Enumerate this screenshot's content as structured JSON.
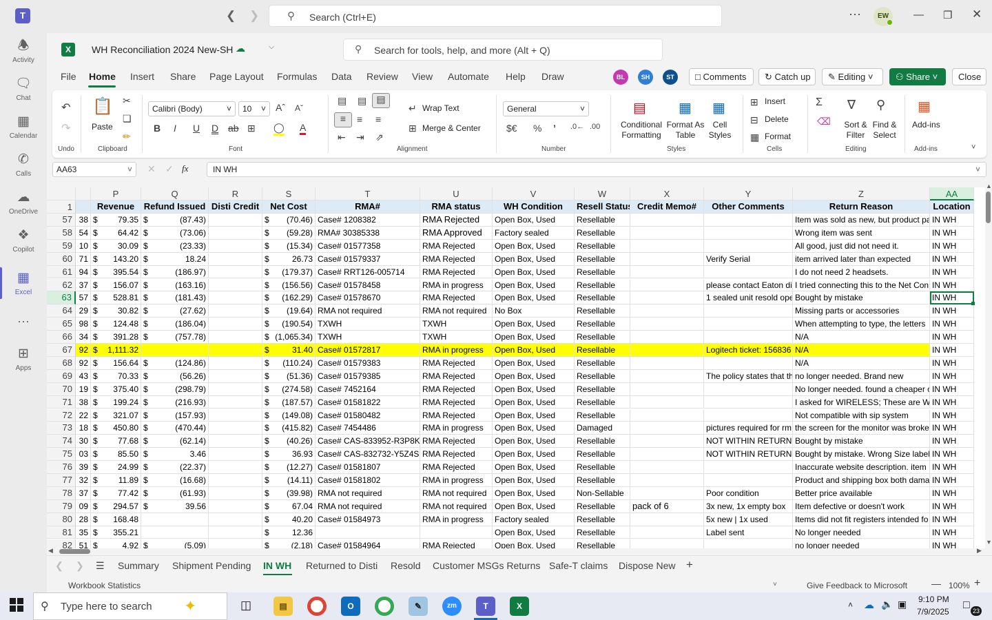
{
  "teams": {
    "search_placeholder": "Search (Ctrl+E)",
    "user_initials": "EW",
    "rail": [
      {
        "label": "Activity",
        "icon": "bell-icon"
      },
      {
        "label": "Chat",
        "icon": "chat-icon"
      },
      {
        "label": "Calendar",
        "icon": "calendar-icon"
      },
      {
        "label": "Calls",
        "icon": "phone-icon"
      },
      {
        "label": "OneDrive",
        "icon": "cloud-icon"
      },
      {
        "label": "Copilot",
        "icon": "copilot-icon"
      },
      {
        "label": "Excel",
        "icon": "excel-icon"
      },
      {
        "label": "Apps",
        "icon": "plus-square-icon"
      }
    ]
  },
  "workbook": {
    "name": "WH Reconciliation 2024 New-SH",
    "tool_search": "Search for tools, help, and more (Alt + Q)"
  },
  "menu": {
    "tabs": [
      "File",
      "Home",
      "Insert",
      "Share",
      "Page Layout",
      "Formulas",
      "Data",
      "Review",
      "View",
      "Automate",
      "Help",
      "Draw"
    ],
    "collaborators": [
      {
        "initials": "BL",
        "color": "#c239b3"
      },
      {
        "initials": "SH",
        "color": "#2f7fd6"
      },
      {
        "initials": "ST",
        "color": "#0e4f8c"
      }
    ],
    "comments": "Comments",
    "catchup": "Catch up",
    "editing": "Editing",
    "share": "Share",
    "close": "Close"
  },
  "ribbon": {
    "undo": "Undo",
    "paste": "Paste",
    "clipboard": "Clipboard",
    "font_name": "Calibri (Body)",
    "font_size": "10",
    "font": "Font",
    "wrap_text": "Wrap Text",
    "merge_center": "Merge & Center",
    "alignment": "Alignment",
    "number_format": "General",
    "number": "Number",
    "cond_format": "Conditional Formatting",
    "format_table": "Format As Table",
    "cell_styles": "Cell Styles",
    "styles": "Styles",
    "insert": "Insert",
    "delete": "Delete",
    "format": "Format",
    "cells": "Cells",
    "sort_filter": "Sort & Filter",
    "find_select": "Find & Select",
    "editing": "Editing",
    "addins": "Add-ins"
  },
  "formula_bar": {
    "name_box": "AA63",
    "content": "IN WH"
  },
  "grid": {
    "columns": [
      "P",
      "Q",
      "R",
      "S",
      "T",
      "U",
      "V",
      "W",
      "X",
      "Y",
      "Z",
      "AA"
    ],
    "header_row": [
      "Revenue",
      "Refund Issued",
      "Disti Credit",
      "Net Cost",
      "RMA#",
      "RMA status",
      "WH Condition",
      "Resell Status",
      "Credit Memo#",
      "Other Comments",
      "Return Reason",
      "Location"
    ],
    "rows": [
      {
        "n": "57",
        "o": "38",
        "p": "79.35",
        "q": "(87.43)",
        "s": "(70.46)",
        "t": "Case# 1208382",
        "u": "RMA Rejected",
        "v": "Open Box, Used",
        "w": "Resellable",
        "x": "",
        "y": "",
        "z": "Item was sold as new, but product pa",
        "aa": "IN WH"
      },
      {
        "n": "58",
        "o": "54",
        "p": "64.42",
        "q": "(73.06)",
        "s": "(59.28)",
        "t": "RMA# 30385338",
        "u": "RMA Approved",
        "v": "Factory sealed",
        "w": "Resellable",
        "x": "",
        "y": "",
        "z": "Wrong item was sent",
        "aa": "IN WH"
      },
      {
        "n": "59",
        "o": "10",
        "p": "30.09",
        "q": "(23.33)",
        "s": "(15.34)",
        "t": "Case# 01577358",
        "u": "RMA Rejected",
        "v": "Open Box, Used",
        "w": "Resellable",
        "x": "",
        "y": "",
        "z": "All good, just did not need it.",
        "aa": "IN WH"
      },
      {
        "n": "60",
        "o": "71",
        "p": "143.20",
        "q": "18.24",
        "s": "26.73",
        "t": "Case# 01579337",
        "u": "RMA Rejected",
        "v": "Open Box, Used",
        "w": "Resellable",
        "x": "",
        "y": "Verify Serial",
        "z": "item arrived later than expected",
        "aa": "IN WH"
      },
      {
        "n": "61",
        "o": "94",
        "p": "395.54",
        "q": "(186.97)",
        "s": "(179.37)",
        "t": "Case# RRT126-005714",
        "u": "RMA Rejected",
        "v": "Open Box, Used",
        "w": "Resellable",
        "x": "",
        "y": "",
        "z": "I do not need 2 headsets.",
        "aa": "IN WH"
      },
      {
        "n": "62",
        "o": "37",
        "p": "156.07",
        "q": "(163.16)",
        "s": "(156.56)",
        "t": "Case# 01578458",
        "u": "RMA in progress",
        "v": "Open Box, Used",
        "w": "Resellable",
        "x": "",
        "y": "please contact Eaton dir",
        "z": "I tried connecting this to the Net Con",
        "aa": "IN WH"
      },
      {
        "n": "63",
        "o": "57",
        "p": "528.81",
        "q": "(181.43)",
        "s": "(162.29)",
        "t": "Case# 01578670",
        "u": "RMA Rejected",
        "v": "Open Box, Used",
        "w": "Resellable",
        "x": "",
        "y": "1 sealed unit resold ope",
        "z": "Bought by mistake",
        "aa": "IN WH"
      },
      {
        "n": "64",
        "o": "29",
        "p": "30.82",
        "q": "(27.62)",
        "s": "(19.64)",
        "t": "RMA not required",
        "u": "RMA not required",
        "v": "No Box",
        "w": "Resellable",
        "x": "",
        "y": "",
        "z": "Missing parts or accessories",
        "aa": "IN WH"
      },
      {
        "n": "65",
        "o": "98",
        "p": "124.48",
        "q": "(186.04)",
        "s": "(190.54)",
        "t": "TXWH",
        "u": "TXWH",
        "v": "Open Box, Used",
        "w": "Resellable",
        "x": "",
        "y": "",
        "z": "When attempting to type, the letters",
        "aa": "IN WH"
      },
      {
        "n": "66",
        "o": "34",
        "p": "391.28",
        "q": "(757.78)",
        "s": "(1,065.34)",
        "t": "TXWH",
        "u": "TXWH",
        "v": "Open Box, Used",
        "w": "Resellable",
        "x": "",
        "y": "",
        "z": "N/A",
        "aa": "IN WH"
      },
      {
        "n": "67",
        "o": "92",
        "p": "1,111.32",
        "q": "",
        "s": "31.40",
        "t": "Case# 01572817",
        "u": "RMA in progress",
        "v": "Open Box, Used",
        "w": "Resellable",
        "x": "",
        "y": "Logitech ticket: 156836",
        "z": "N/A",
        "aa": "IN WH"
      },
      {
        "n": "68",
        "o": "92",
        "p": "156.64",
        "q": "(124.86)",
        "s": "(110.24)",
        "t": "Case# 01579383",
        "u": "RMA Rejected",
        "v": "Open Box, Used",
        "w": "Resellable",
        "x": "",
        "y": "",
        "z": "N/A",
        "aa": "IN WH"
      },
      {
        "n": "69",
        "o": "43",
        "p": "70.33",
        "q": "(56.26)",
        "s": "(51.36)",
        "t": "Case# 01579385",
        "u": "RMA Rejected",
        "v": "Open Box, Used",
        "w": "Resellable",
        "x": "",
        "y": "The policy states that th",
        "z": "no longer needed. Brand new",
        "aa": "IN WH"
      },
      {
        "n": "70",
        "o": "19",
        "p": "375.40",
        "q": "(298.79)",
        "s": "(274.58)",
        "t": "Case# 7452164",
        "u": "RMA Rejected",
        "v": "Open Box, Used",
        "w": "Resellable",
        "x": "",
        "y": "",
        "z": "No longer needed. found a cheaper c",
        "aa": "IN WH"
      },
      {
        "n": "71",
        "o": "38",
        "p": "199.24",
        "q": "(216.93)",
        "s": "(187.57)",
        "t": "Case# 01581822",
        "u": "RMA Rejected",
        "v": "Open Box, Used",
        "w": "Resellable",
        "x": "",
        "y": "",
        "z": "I asked for WIRELESS; These are WIR",
        "aa": "IN WH"
      },
      {
        "n": "72",
        "o": "22",
        "p": "321.07",
        "q": "(157.93)",
        "s": "(149.08)",
        "t": "Case# 01580482",
        "u": "RMA Rejected",
        "v": "Open Box, Used",
        "w": "Resellable",
        "x": "",
        "y": "",
        "z": "Not compatible with sip system",
        "aa": "IN WH"
      },
      {
        "n": "73",
        "o": "18",
        "p": "450.80",
        "q": "(470.44)",
        "s": "(415.82)",
        "t": "Case# 7454486",
        "u": "RMA in progress",
        "v": "Open Box, Used",
        "w": "Damaged",
        "x": "",
        "y": "pictures required for rm",
        "z": "the screen for the monitor was broke",
        "aa": "IN WH"
      },
      {
        "n": "74",
        "o": "30",
        "p": "77.68",
        "q": "(62.14)",
        "s": "(40.26)",
        "t": "Case# CAS-833952-R3P8K6-1",
        "u": "RMA Rejected",
        "v": "Open Box, Used",
        "w": "Resellable",
        "x": "",
        "y": "NOT WITHIN RETURN P",
        "z": "Bought by mistake",
        "aa": "IN WH"
      },
      {
        "n": "75",
        "o": "03",
        "p": "85.50",
        "q": "3.46",
        "s": "36.93",
        "t": "Case# CAS-832732-Y5Z4S2-1",
        "u": "RMA Rejected",
        "v": "Open Box, Used",
        "w": "Resellable",
        "x": "",
        "y": "NOT WITHIN RETURN P",
        "z": "Bought by mistake. Wrong Size labels",
        "aa": "IN WH"
      },
      {
        "n": "76",
        "o": "39",
        "p": "24.99",
        "q": "(22.37)",
        "s": "(12.27)",
        "t": "Case# 01581807",
        "u": "RMA Rejected",
        "v": "Open Box, Used",
        "w": "Resellable",
        "x": "",
        "y": "",
        "z": "Inaccurate website description. item",
        "aa": "IN WH"
      },
      {
        "n": "77",
        "o": "32",
        "p": "11.89",
        "q": "(16.68)",
        "s": "(14.11)",
        "t": "Case# 01581802",
        "u": "RMA in progress",
        "v": "Open Box, Used",
        "w": "Resellable",
        "x": "",
        "y": "",
        "z": "Product and shipping box both dama",
        "aa": "IN WH"
      },
      {
        "n": "78",
        "o": "37",
        "p": "77.42",
        "q": "(61.93)",
        "s": "(39.98)",
        "t": "RMA not required",
        "u": "RMA not required",
        "v": "Open Box, Used",
        "w": "Non-Sellable",
        "x": "",
        "y": "Poor condition",
        "z": "Better price available",
        "aa": "IN WH"
      },
      {
        "n": "79",
        "o": "09",
        "p": "294.57",
        "q": "39.56",
        "s": "67.04",
        "t": "RMA not required",
        "u": "RMA not required",
        "v": "Open Box, Used",
        "w": "Resellable",
        "x": "pack of 6",
        "y": "3x new, 1x empty box",
        "z": "Item defective or doesn't work",
        "aa": "IN WH"
      },
      {
        "n": "80",
        "o": "28",
        "p": "168.48",
        "q": "",
        "s": "40.20",
        "t": "Case# 01584973",
        "u": "RMA in progress",
        "v": "Factory sealed",
        "w": "Resellable",
        "x": "",
        "y": "5x new | 1x used",
        "z": "Items did not fit registers intended fo",
        "aa": "IN WH"
      },
      {
        "n": "81",
        "o": "35",
        "p": "355.21",
        "q": "",
        "s": "12.36",
        "t": "",
        "u": "",
        "v": "Open Box, Used",
        "w": "Resellable",
        "x": "",
        "y": "Label sent",
        "z": "No longer needed",
        "aa": "IN WH"
      },
      {
        "n": "82",
        "o": "51",
        "p": "4.92",
        "q": "(5.09)",
        "s": "(2.18)",
        "t": "Case# 01584964",
        "u": "RMA Rejected",
        "v": "Open Box, Used",
        "w": "Resellable",
        "x": "",
        "y": "",
        "z": "no longer needed",
        "aa": "IN WH"
      }
    ]
  },
  "sheets": [
    "Summary",
    "Shipment Pending",
    "IN WH",
    "Returned to Disti",
    "Resold",
    "Customer MSGs Returns",
    "Safe-T claims",
    "Dispose New"
  ],
  "status": {
    "left": "Workbook Statistics",
    "feedback": "Give Feedback to Microsoft",
    "zoom": "100%"
  },
  "taskbar": {
    "search": "Type here to search",
    "time": "9:10 PM",
    "date": "7/9/2025",
    "notifications": "23"
  },
  "colors": {
    "excel_green": "#107c41",
    "teams_purple": "#5b5fc7",
    "highlight_yellow": "#ffff00",
    "header_blue": "#ddebf7"
  }
}
